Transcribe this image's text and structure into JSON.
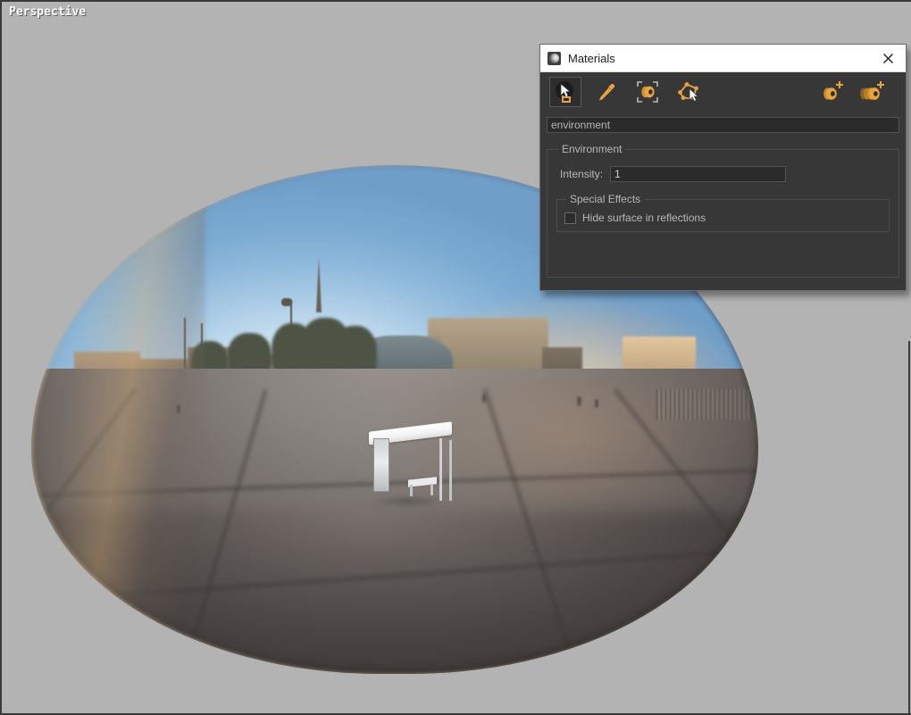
{
  "viewport": {
    "label": "Perspective",
    "background_color": "#b3b3b3",
    "scene_description": "Chrome reflective sphere reflecting an urban plaza with buildings, trees, a church spire and a white bus-shelter object"
  },
  "panel": {
    "title": "Materials",
    "title_icon": "material-sphere-icon",
    "close_icon": "close-icon",
    "toolbar": {
      "left_tools": [
        {
          "name": "pick-material-tool",
          "icon": "sphere-cursor-icon",
          "active": true
        },
        {
          "name": "eyedropper-tool",
          "icon": "eyedropper-icon",
          "active": false
        },
        {
          "name": "select-objects-by-material-tool",
          "icon": "sphere-in-marquee-icon",
          "active": false
        },
        {
          "name": "assign-material-tool",
          "icon": "polygon-cursor-icon",
          "active": false
        }
      ],
      "right_tools": [
        {
          "name": "add-material-button",
          "icon": "sphere-plus-icon"
        },
        {
          "name": "add-material-stack-button",
          "icon": "sphere-stack-plus-icon"
        }
      ]
    },
    "material_name": "environment",
    "material_name_placeholder": "environment",
    "environment_group": {
      "legend": "Environment",
      "intensity_label": "Intensity:",
      "intensity_value": "1",
      "special_effects_group": {
        "legend": "Special Effects",
        "hide_surface_label": "Hide surface in reflections",
        "hide_surface_checked": false
      }
    }
  },
  "colors": {
    "panel_background": "#373737",
    "panel_border": "#6d6d6d",
    "titlebar_background": "#ffffff",
    "titlebar_text": "#1d1d1d",
    "accent_orange": "#e8a33d",
    "field_background": "#2b2b2b",
    "label_text": "#b8b8b8",
    "viewport_background": "#b3b3b3"
  }
}
